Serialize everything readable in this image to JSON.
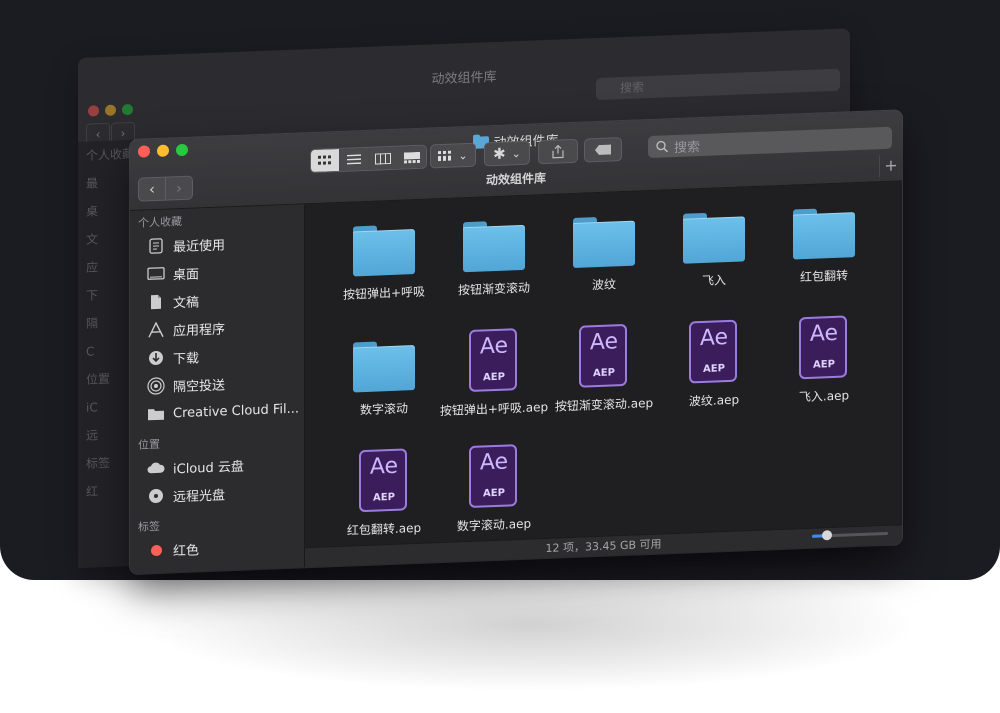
{
  "window_title": "动效组件库",
  "path_title": "动效组件库",
  "search": {
    "placeholder": "搜索"
  },
  "nav": {
    "back": "‹",
    "forward": "›"
  },
  "back_window": {
    "title": "动效组件库",
    "search_placeholder": "搜索",
    "sidebar": [
      "个人收藏",
      "最",
      "桌",
      "文",
      "应",
      "下",
      "隔",
      "C",
      "位置",
      "iC",
      "远",
      "标签",
      "红"
    ]
  },
  "sidebar": {
    "favorites_header": "个人收藏",
    "favorites": [
      {
        "label": "最近使用",
        "icon": "recents-icon"
      },
      {
        "label": "桌面",
        "icon": "desktop-icon"
      },
      {
        "label": "文稿",
        "icon": "documents-icon"
      },
      {
        "label": "应用程序",
        "icon": "applications-icon"
      },
      {
        "label": "下载",
        "icon": "downloads-icon"
      },
      {
        "label": "隔空投送",
        "icon": "airdrop-icon"
      },
      {
        "label": "Creative Cloud Fil...",
        "icon": "folder-icon"
      }
    ],
    "locations_header": "位置",
    "locations": [
      {
        "label": "iCloud 云盘",
        "icon": "cloud-icon"
      },
      {
        "label": "远程光盘",
        "icon": "disc-icon"
      }
    ],
    "tags_header": "标签",
    "tags": [
      {
        "label": "红色",
        "color": "#ff5f57"
      }
    ]
  },
  "items": [
    {
      "name": "按钮弹出+呼吸",
      "kind": "folder"
    },
    {
      "name": "按钮渐变滚动",
      "kind": "folder"
    },
    {
      "name": "波纹",
      "kind": "folder"
    },
    {
      "name": "飞入",
      "kind": "folder"
    },
    {
      "name": "红包翻转",
      "kind": "folder"
    },
    {
      "name": "数字滚动",
      "kind": "folder"
    },
    {
      "name": "按钮弹出+呼吸.aep",
      "kind": "aep"
    },
    {
      "name": "按钮渐变滚动.aep",
      "kind": "aep"
    },
    {
      "name": "波纹.aep",
      "kind": "aep"
    },
    {
      "name": "飞入.aep",
      "kind": "aep"
    },
    {
      "name": "红包翻转.aep",
      "kind": "aep"
    },
    {
      "name": "数字滚动.aep",
      "kind": "aep"
    }
  ],
  "aep_badge": {
    "top": "Ae",
    "bottom": "AEP"
  },
  "status": "12 项，33.45 GB 可用",
  "icon_size_slider": 0.2,
  "colors": {
    "folder": "#5aaee0",
    "aep_border": "#9a7ce0",
    "aep_bg": "#3a1d5a",
    "accent": "#3b8ef0"
  }
}
